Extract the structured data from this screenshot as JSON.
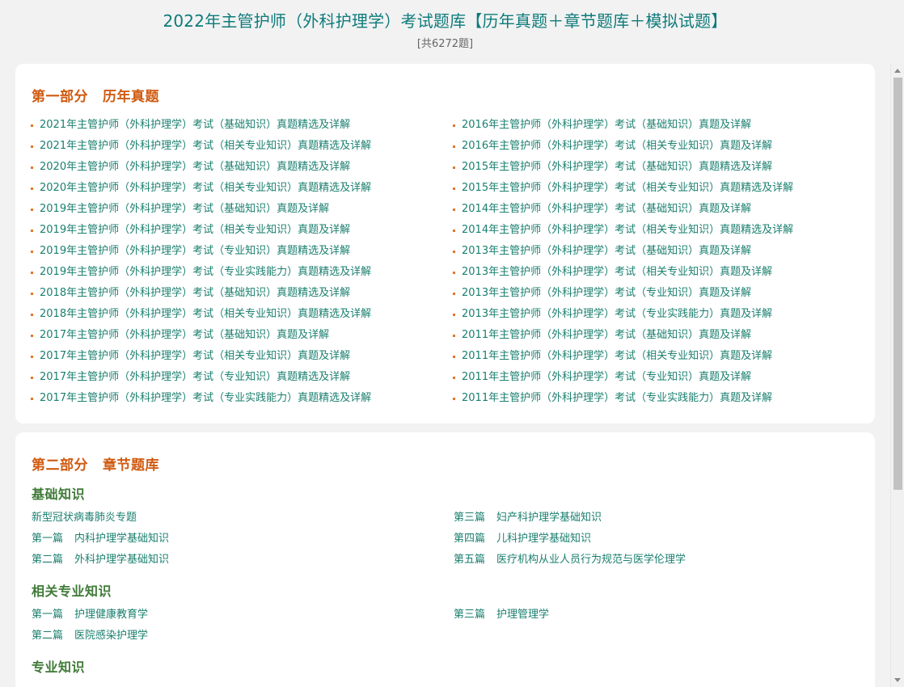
{
  "header": {
    "title": "2022年主管护师（外科护理学）考试题库【历年真题＋章节题库＋模拟试题】",
    "count": "[共6272题]"
  },
  "part1": {
    "label": "第一部分",
    "title": "历年真题",
    "left": [
      "2021年主管护师（外科护理学）考试（基础知识）真题精选及详解",
      "2021年主管护师（外科护理学）考试（相关专业知识）真题精选及详解",
      "2020年主管护师（外科护理学）考试（基础知识）真题精选及详解",
      "2020年主管护师（外科护理学）考试（相关专业知识）真题精选及详解",
      "2019年主管护师（外科护理学）考试（基础知识）真题及详解",
      "2019年主管护师（外科护理学）考试（相关专业知识）真题及详解",
      "2019年主管护师（外科护理学）考试（专业知识）真题精选及详解",
      "2019年主管护师（外科护理学）考试（专业实践能力）真题精选及详解",
      "2018年主管护师（外科护理学）考试（基础知识）真题精选及详解",
      "2018年主管护师（外科护理学）考试（相关专业知识）真题精选及详解",
      "2017年主管护师（外科护理学）考试（基础知识）真题及详解",
      "2017年主管护师（外科护理学）考试（相关专业知识）真题及详解",
      "2017年主管护师（外科护理学）考试（专业知识）真题精选及详解",
      "2017年主管护师（外科护理学）考试（专业实践能力）真题精选及详解"
    ],
    "right": [
      "2016年主管护师（外科护理学）考试（基础知识）真题及详解",
      "2016年主管护师（外科护理学）考试（相关专业知识）真题及详解",
      "2015年主管护师（外科护理学）考试（基础知识）真题精选及详解",
      "2015年主管护师（外科护理学）考试（相关专业知识）真题精选及详解",
      "2014年主管护师（外科护理学）考试（基础知识）真题及详解",
      "2014年主管护师（外科护理学）考试（相关专业知识）真题精选及详解",
      "2013年主管护师（外科护理学）考试（基础知识）真题及详解",
      "2013年主管护师（外科护理学）考试（相关专业知识）真题及详解",
      "2013年主管护师（外科护理学）考试（专业知识）真题及详解",
      "2013年主管护师（外科护理学）考试（专业实践能力）真题及详解",
      "2011年主管护师（外科护理学）考试（基础知识）真题及详解",
      "2011年主管护师（外科护理学）考试（相关专业知识）真题及详解",
      "2011年主管护师（外科护理学）考试（专业知识）真题及详解",
      "2011年主管护师（外科护理学）考试（专业实践能力）真题及详解"
    ]
  },
  "part2": {
    "label": "第二部分",
    "title": "章节题库",
    "groups": [
      {
        "title": "基础知识",
        "left": [
          {
            "num": "",
            "name": "新型冠状病毒肺炎专题"
          },
          {
            "num": "第一篇",
            "name": "内科护理学基础知识"
          },
          {
            "num": "第二篇",
            "name": "外科护理学基础知识"
          }
        ],
        "right": [
          {
            "num": "第三篇",
            "name": "妇产科护理学基础知识"
          },
          {
            "num": "第四篇",
            "name": "儿科护理学基础知识"
          },
          {
            "num": "第五篇",
            "name": "医疗机构从业人员行为规范与医学伦理学"
          }
        ]
      },
      {
        "title": "相关专业知识",
        "left": [
          {
            "num": "第一篇",
            "name": "护理健康教育学"
          },
          {
            "num": "第二篇",
            "name": "医院感染护理学"
          }
        ],
        "right": [
          {
            "num": "第三篇",
            "name": "护理管理学"
          }
        ]
      },
      {
        "title": "专业知识",
        "left": [],
        "right": []
      }
    ]
  }
}
